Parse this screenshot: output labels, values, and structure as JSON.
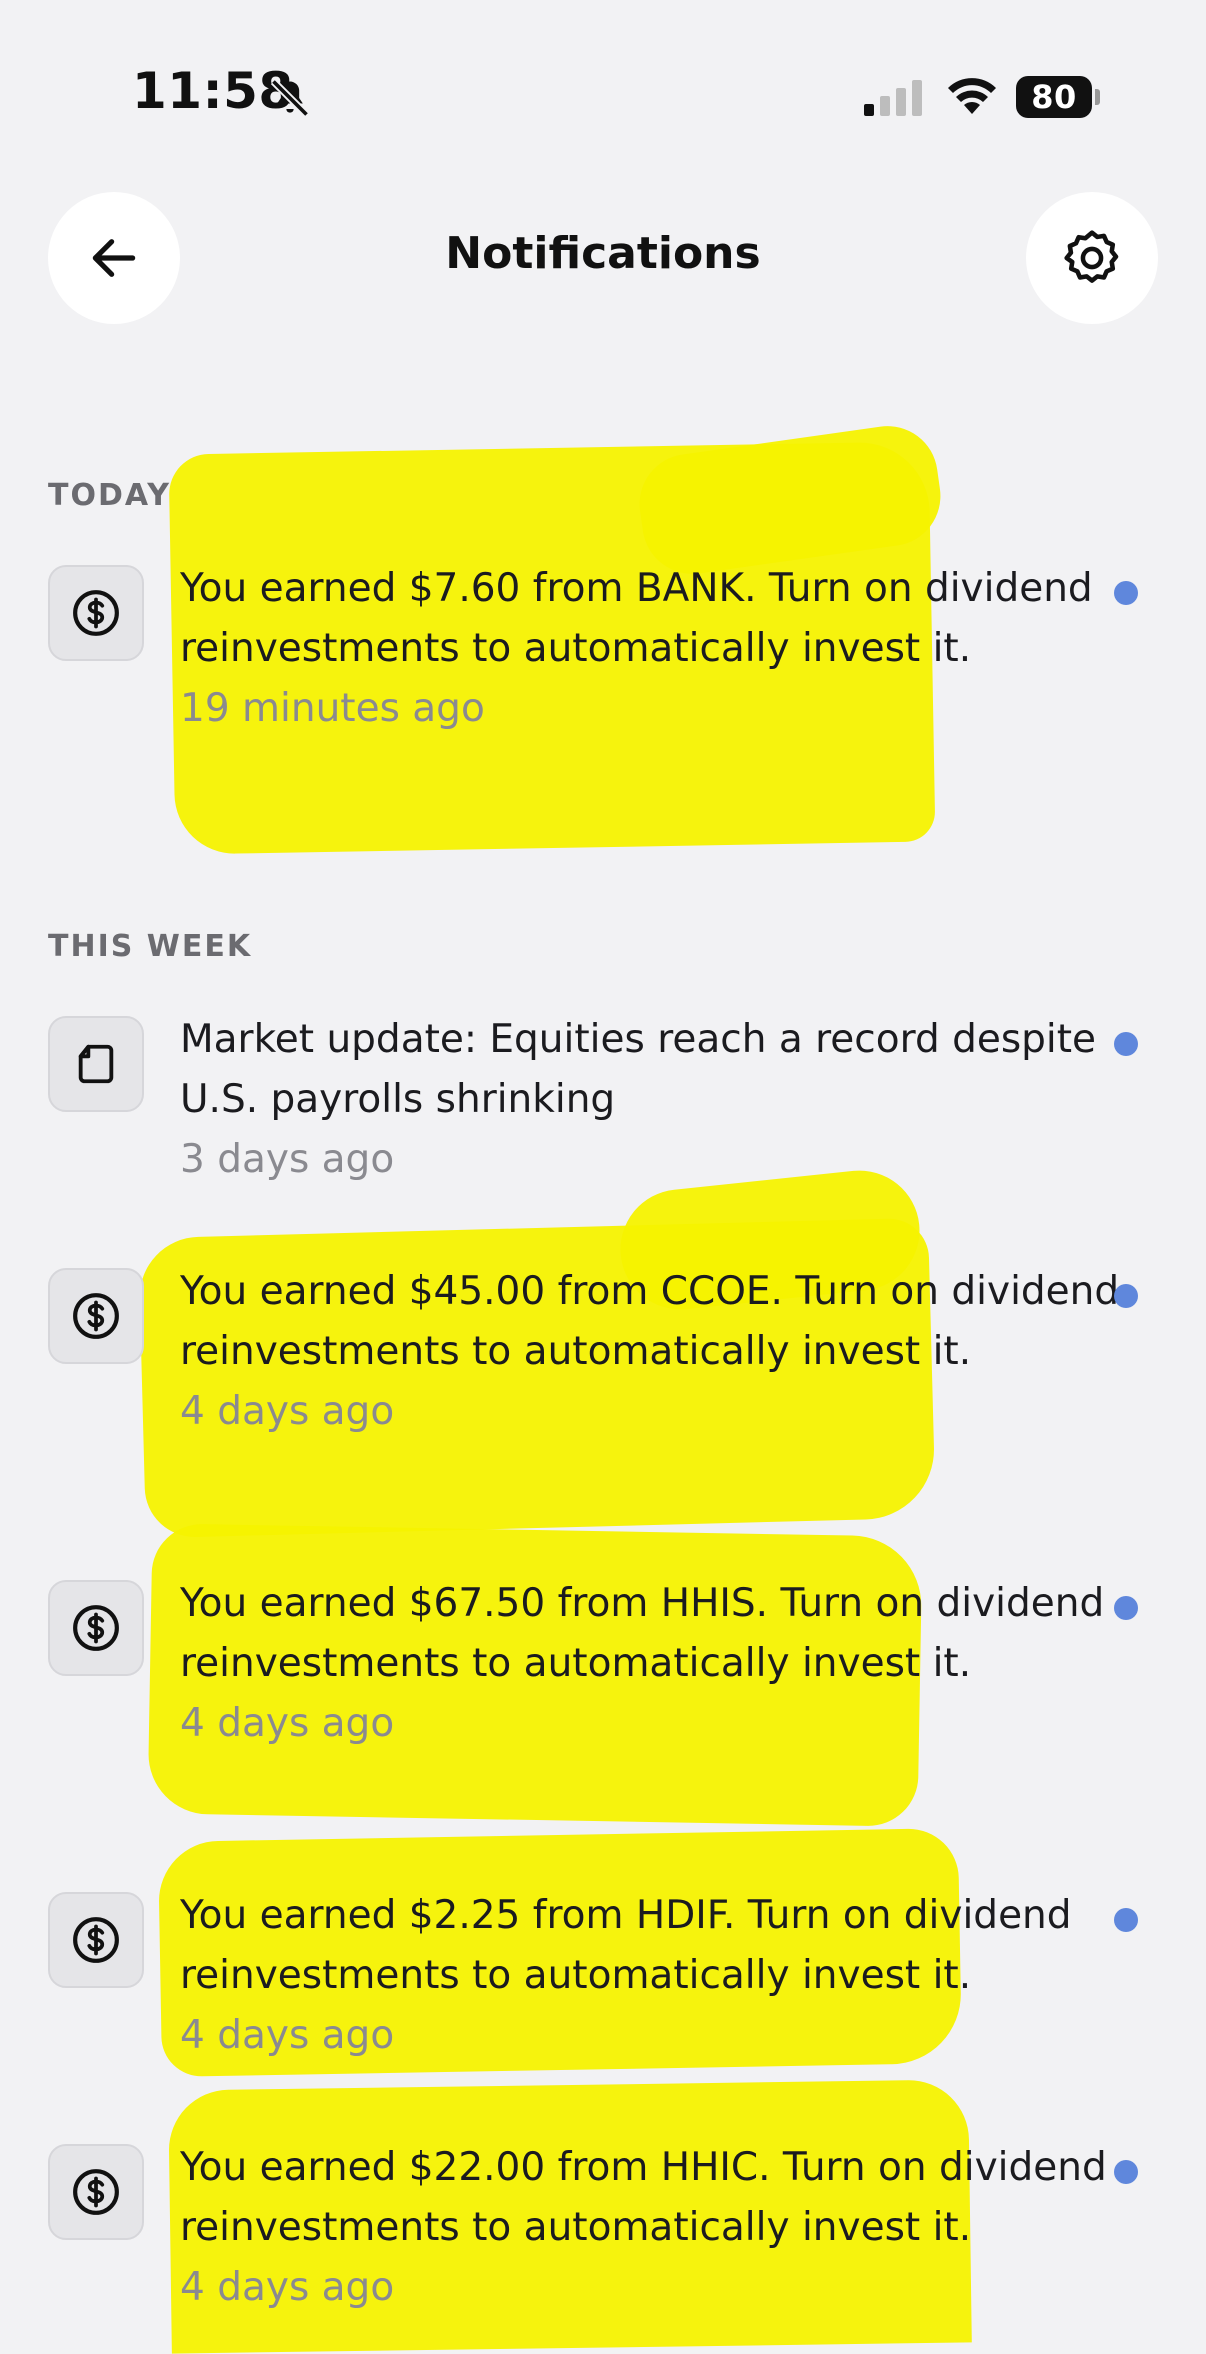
{
  "status_bar": {
    "time": "11:58",
    "battery": "80"
  },
  "header": {
    "title": "Notifications"
  },
  "sections": [
    {
      "label": "TODAY",
      "items": [
        {
          "icon": "dollar-icon",
          "text": "You earned $7.60 from BANK. Turn on dividend reinvestments to automatically invest it.",
          "time": "19 minutes ago",
          "unread": true
        }
      ]
    },
    {
      "label": "THIS WEEK",
      "items": [
        {
          "icon": "document-icon",
          "text": "Market update: Equities reach a record despite U.S. payrolls shrinking",
          "time": "3 days ago",
          "unread": true
        },
        {
          "icon": "dollar-icon",
          "text": "You earned $45.00 from CCOE. Turn on dividend reinvestments to automatically invest it.",
          "time": "4 days ago",
          "unread": true
        },
        {
          "icon": "dollar-icon",
          "text": "You earned $67.50 from HHIS. Turn on dividend reinvestments to automatically invest it.",
          "time": "4 days ago",
          "unread": true
        },
        {
          "icon": "dollar-icon",
          "text": "You earned $2.25 from HDIF. Turn on dividend reinvestments to automatically invest it.",
          "time": "4 days ago",
          "unread": true
        },
        {
          "icon": "dollar-icon",
          "text": "You earned $22.00 from HHIC. Turn on dividend reinvestments to automatically invest it.",
          "time": "4 days ago",
          "unread": true
        }
      ]
    }
  ],
  "colors": {
    "background": "#f2f2f4",
    "unread_dot": "#5f87dc",
    "highlight": "#f6f200"
  }
}
